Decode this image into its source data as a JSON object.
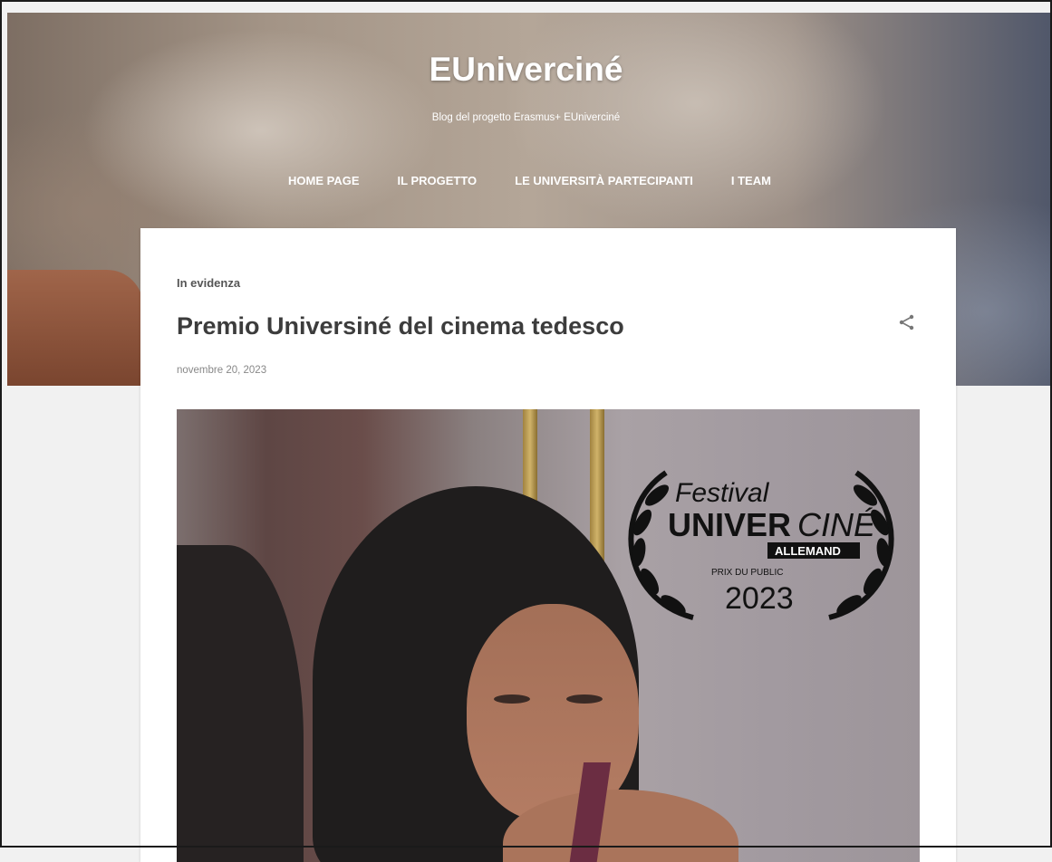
{
  "blog": {
    "title": "EUniverciné",
    "description": "Blog del progetto Erasmus+ EUniverciné"
  },
  "nav": {
    "items": [
      {
        "label": "HOME PAGE"
      },
      {
        "label": "IL PROGETTO"
      },
      {
        "label": "LE UNIVERSITÀ PARTECIPANTI"
      },
      {
        "label": "I TEAM"
      }
    ]
  },
  "featured": {
    "section_label": "In evidenza",
    "post_title": "Premio Universiné del cinema tedesco",
    "date": "novembre 20, 2023",
    "share_icon": "share-icon",
    "image": {
      "festival_line": "Festival",
      "brand_bold": "UNIVER",
      "brand_italic": "CINÉ",
      "country": "ALLEMAND",
      "award": "PRIX DU PUBLIC",
      "year": "2023"
    }
  }
}
